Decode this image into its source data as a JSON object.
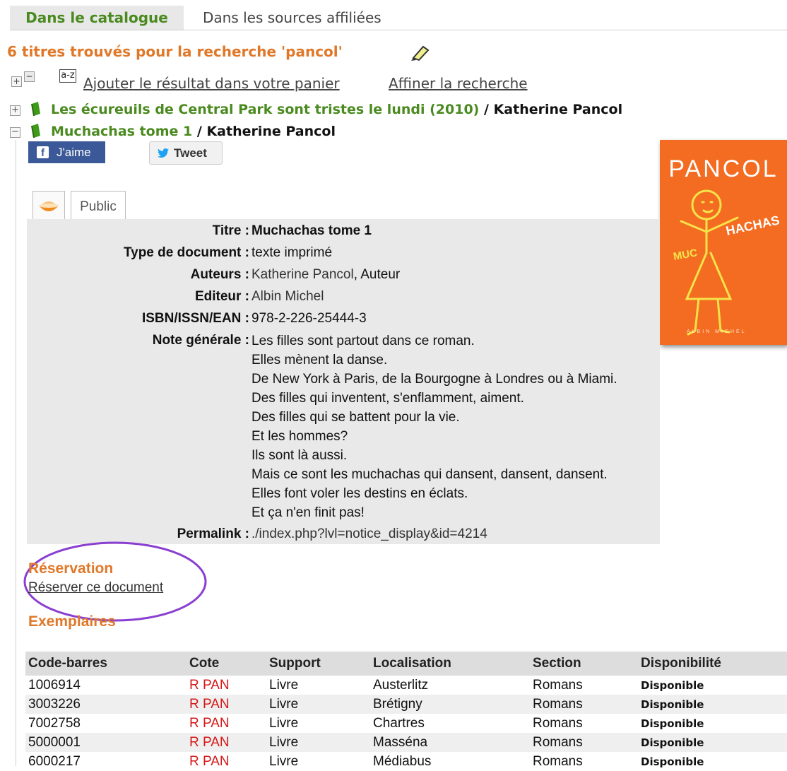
{
  "tabs": {
    "catalogue": "Dans le catalogue",
    "affiliates": "Dans les sources affiliées"
  },
  "results": {
    "title": "6 titres trouvés pour la recherche 'pancol'"
  },
  "toolbar": {
    "sort_label": "a-z",
    "add_to_basket": "Ajouter le résultat dans votre panier",
    "refine": "Affiner la recherche"
  },
  "records": [
    {
      "title": "Les écureuils de Central Park sont tristes le lundi (2010)",
      "separator": "/",
      "author": "Katherine Pancol",
      "toggle": "+"
    },
    {
      "title": "Muchachas tome 1",
      "separator": "/",
      "author": "Katherine Pancol",
      "toggle": "−"
    }
  ],
  "social": {
    "like": "J'aime",
    "tweet": "Tweet"
  },
  "cover": {
    "author_text": "PANCOL",
    "title_text": "MUCHACHAS",
    "brand_color": "#f36c21"
  },
  "notice_tabs": {
    "public": "Public"
  },
  "notice": {
    "fields": [
      {
        "key": "Titre :",
        "value": "Muchachas tome 1",
        "bold": true
      },
      {
        "key": "Type de document :",
        "value": "texte imprimé"
      },
      {
        "key": "Auteurs :",
        "link": "Katherine Pancol",
        "suffix": ", Auteur"
      },
      {
        "key": "Editeur :",
        "link": "Albin Michel"
      },
      {
        "key": "ISBN/ISSN/EAN :",
        "value": "978-2-226-25444-3"
      }
    ],
    "note_key": "Note générale :",
    "note_lines": [
      "Les filles sont partout dans ce roman.",
      "Elles mènent la danse.",
      "De New York à Paris, de la Bourgogne à Londres ou à Miami.",
      "Des filles qui inventent, s'enflamment, aiment.",
      "Des filles qui se battent pour la vie.",
      "Et les hommes?",
      "Ils sont là aussi.",
      "Mais ce sont les muchachas qui dansent, dansent, dansent.",
      "Elles font voler les destins en éclats.",
      "Et ça n'en finit pas!"
    ],
    "permalink_key": "Permalink :",
    "permalink": "./index.php?lvl=notice_display&id=4214"
  },
  "reservation": {
    "heading": "Réservation",
    "link": "Réserver ce document"
  },
  "exemplaires": {
    "heading": "Exemplaires",
    "columns": [
      "Code-barres",
      "Cote",
      "Support",
      "Localisation",
      "Section",
      "Disponibilité"
    ],
    "rows": [
      [
        "1006914",
        "R PAN",
        "Livre",
        "Austerlitz",
        "Romans",
        "Disponible"
      ],
      [
        "3003226",
        "R PAN",
        "Livre",
        "Brétigny",
        "Romans",
        "Disponible"
      ],
      [
        "7002758",
        "R PAN",
        "Livre",
        "Chartres",
        "Romans",
        "Disponible"
      ],
      [
        "5000001",
        "R PAN",
        "Livre",
        "Masséna",
        "Romans",
        "Disponible"
      ],
      [
        "6000217",
        "R PAN",
        "Livre",
        "Médiabus",
        "Romans",
        "Disponible"
      ]
    ]
  },
  "colors": {
    "green": "#4a8a1f",
    "orange": "#e0782a",
    "cote_red": "#d51818",
    "annotation_purple": "#8a3fd1"
  }
}
